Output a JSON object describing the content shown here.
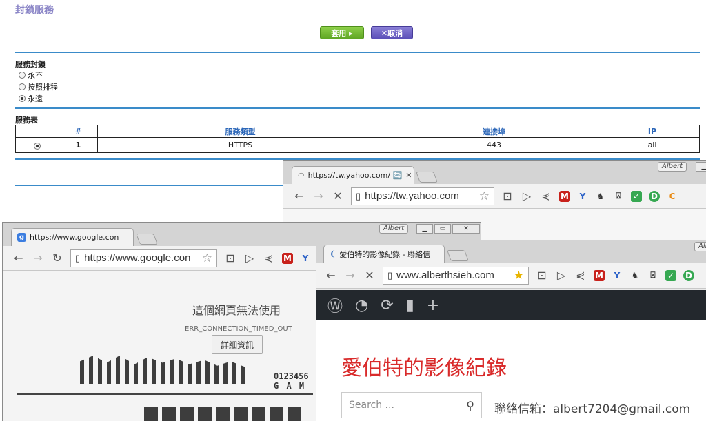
{
  "router": {
    "title": "封鎖服務",
    "apply_label": "套用 ▸",
    "cancel_label": "✕取消",
    "block_section_label": "服務封鎖",
    "radio_options": [
      "永不",
      "按照排程",
      "永遠"
    ],
    "selected_option": "永遠",
    "table_section_label": "服務表",
    "table": {
      "headers": [
        "#",
        "服務類型",
        "連接埠",
        "IP"
      ],
      "rows": [
        {
          "num": "1",
          "service": "HTTPS",
          "port": "443",
          "ip": "all"
        }
      ]
    }
  },
  "yahoo_window": {
    "profile": "Albert",
    "tab_title": "https://tw.yahoo.com/ 🔄",
    "url": "https://tw.yahoo.com"
  },
  "google_window": {
    "profile": "Albert",
    "tab_title": "https://www.google.con",
    "url": "https://www.google.con",
    "error_title": "這個網頁無法使用",
    "error_code": "ERR_CONNECTION_TIMED_OUT",
    "details_button": "詳細資訊",
    "dino_score": "0123456",
    "game_label": "G A M"
  },
  "albert_window": {
    "profile": "Alb",
    "tab_title": "愛伯特的影像紀錄 - 聯絡信",
    "url": "www.alberthsieh.com",
    "blog_title": "愛伯特的影像紀錄",
    "search_placeholder": "Search ...",
    "contact": "聯絡信箱：albert7204@gmail.com"
  },
  "icons": [
    "back-icon",
    "forward-icon",
    "stop-icon",
    "reload-icon",
    "page-icon",
    "star-icon",
    "wordpress-icon",
    "dashboard-icon",
    "update-icon",
    "comment-icon",
    "plus-icon",
    "search-icon"
  ],
  "colors": {
    "apply": "#6cb82f",
    "cancel": "#6257c2",
    "rule": "#3a8bc9",
    "blog_title": "#d92b2b",
    "wp_bar": "#23282d"
  }
}
